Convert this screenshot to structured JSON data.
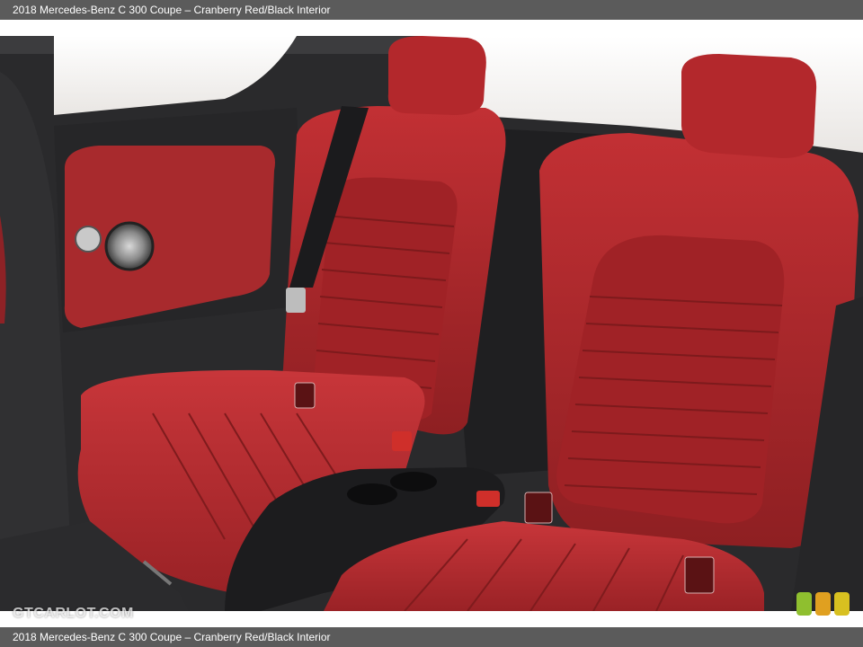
{
  "caption_top": "2018 Mercedes-Benz C 300 Coupe – Cranberry Red/Black Interior",
  "caption_bottom": "2018 Mercedes-Benz C 300 Coupe – Cranberry Red/Black Interior",
  "watermark": "GTCARLOT.COM",
  "photo": {
    "subject": "rear seats of a coupe, red leather with black center section",
    "colors": {
      "leather_red": "#b3282c",
      "leather_dark_red": "#7a1a1c",
      "black_trim": "#1f1f21",
      "window_light": "#f4f2f0"
    }
  },
  "logo_colors": [
    "#8fbf2f",
    "#e0a020",
    "#d8c020"
  ]
}
